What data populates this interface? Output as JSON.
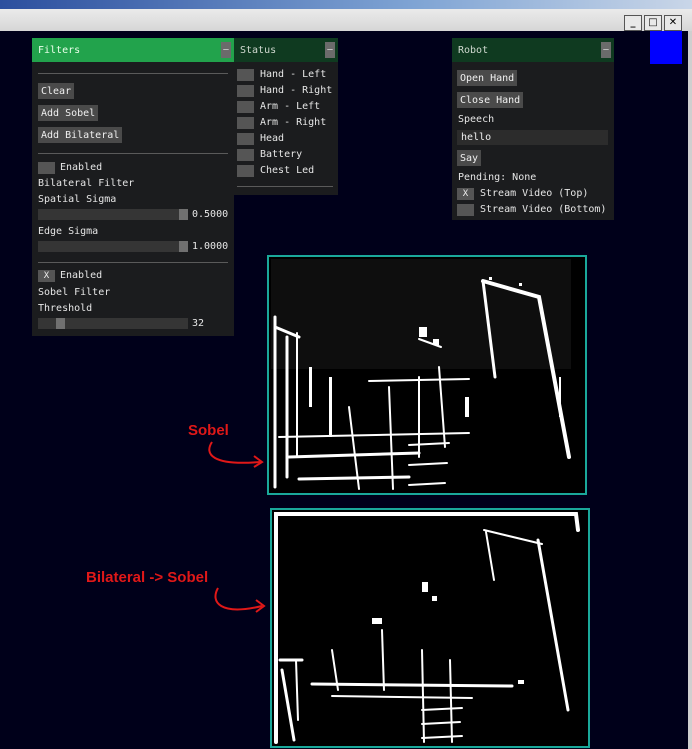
{
  "window": {
    "buttons": {
      "minimize": "_",
      "maximize": "□",
      "close": "✕"
    }
  },
  "filters": {
    "title": "Filters",
    "collapse": "–",
    "clear_label": "Clear",
    "add_sobel_label": "Add Sobel",
    "add_bilateral_label": "Add Bilateral",
    "bilateral": {
      "enabled_label": "Enabled",
      "enabled_check": "",
      "name": "Bilateral Filter",
      "spatial_sigma_label": "Spatial Sigma",
      "spatial_sigma_value": "0.5000",
      "spatial_sigma_fraction": 1.0,
      "edge_sigma_label": "Edge Sigma",
      "edge_sigma_value": "1.0000",
      "edge_sigma_fraction": 1.0
    },
    "sobel": {
      "enabled_label": "Enabled",
      "enabled_check": "X",
      "name": "Sobel Filter",
      "threshold_label": "Threshold",
      "threshold_value": "32",
      "threshold_fraction": 0.125
    }
  },
  "status": {
    "title": "Status",
    "collapse": "–",
    "items": [
      {
        "label": "Hand - Left"
      },
      {
        "label": "Hand - Right"
      },
      {
        "label": "Arm - Left"
      },
      {
        "label": "Arm - Right"
      },
      {
        "label": "Head"
      },
      {
        "label": "Battery"
      },
      {
        "label": "Chest Led"
      }
    ]
  },
  "robot": {
    "title": "Robot",
    "collapse": "–",
    "open_hand_label": "Open Hand",
    "close_hand_label": "Close Hand",
    "speech_label": "Speech",
    "speech_value": "hello",
    "say_label": "Say",
    "pending_text": "Pending: None",
    "stream_top_label": "Stream Video (Top)",
    "stream_top_check": "X",
    "stream_bottom_label": "Stream Video (Bottom)",
    "stream_bottom_check": ""
  },
  "annotations": {
    "sobel": "Sobel",
    "bilateral_sobel": "Bilateral -> Sobel"
  },
  "colors": {
    "background": "#00001a",
    "active_header": "#22a34c",
    "inactive_header": "#0f3a20",
    "frame_border": "#1aa89a",
    "annotation": "#e01818",
    "blue_square": "#0000ff"
  }
}
